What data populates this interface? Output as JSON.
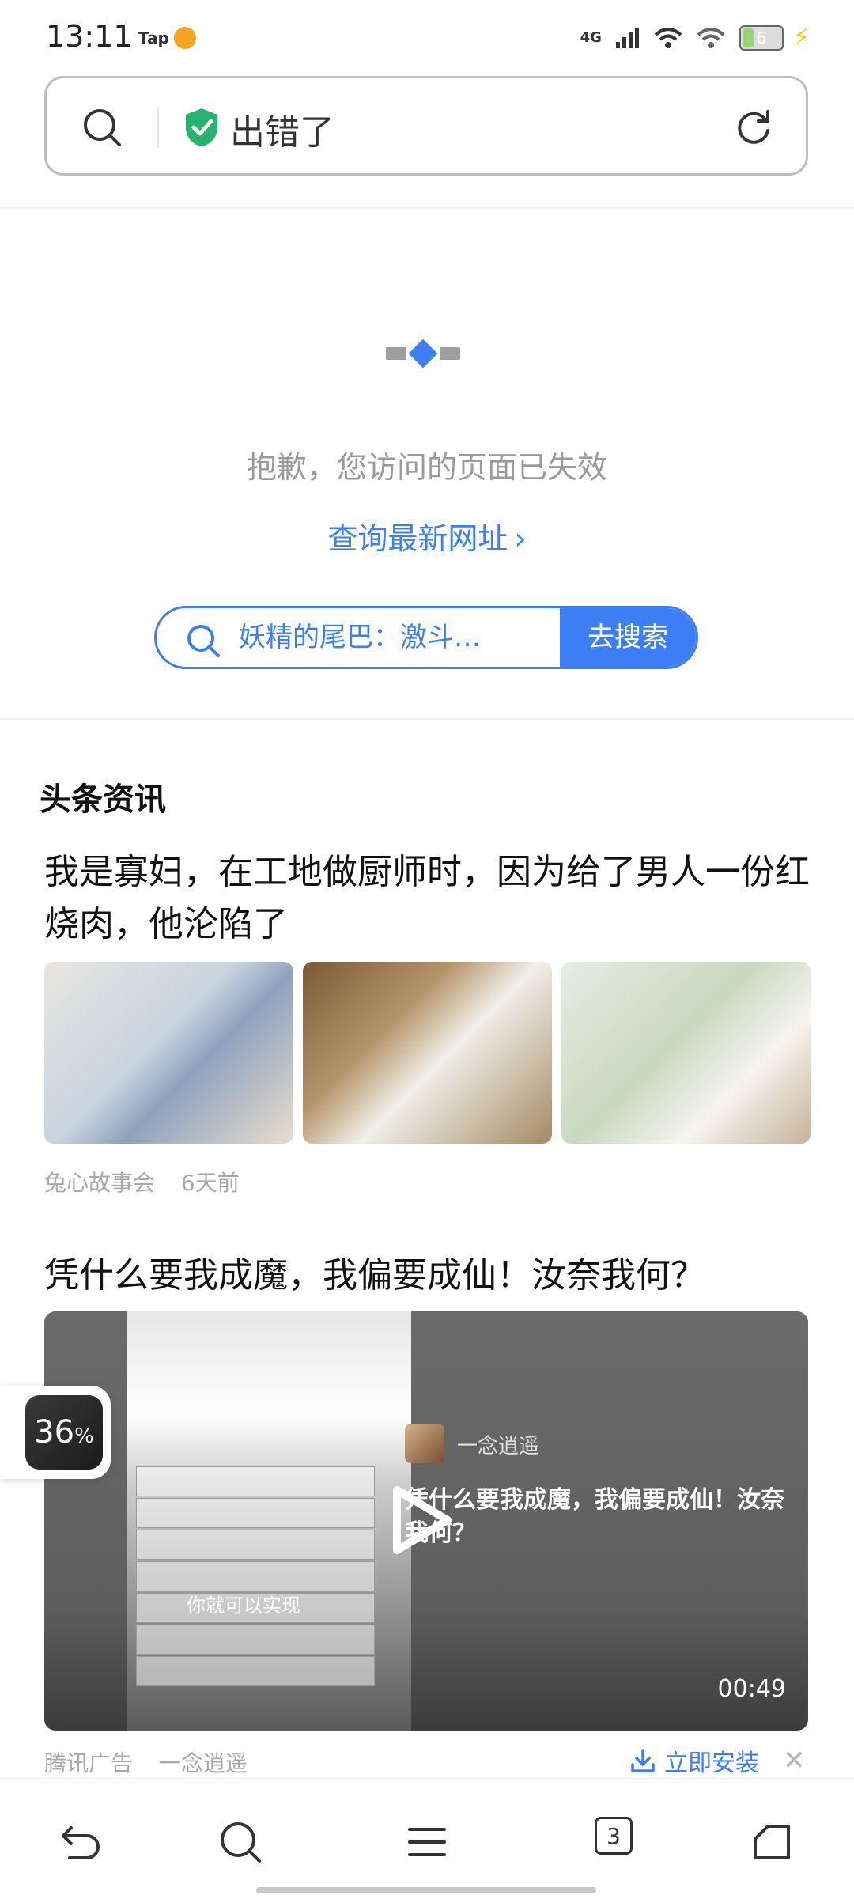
{
  "status_bar": {
    "time": "13:11",
    "tap_label": "Tap",
    "network": "4G",
    "battery": "6"
  },
  "address_bar": {
    "title": "出错了",
    "search_icon": "search-icon",
    "secure_icon": "shield-check-icon",
    "reload_icon": "reload-icon"
  },
  "error_page": {
    "message": "抱歉，您访问的页面已失效",
    "link_label": "查询最新网址",
    "search_suggestion": "妖精的尾巴：激斗…",
    "search_button": "去搜索"
  },
  "news": {
    "section_title": "头条资讯",
    "items": [
      {
        "title": "我是寡妇，在工地做厨师时，因为给了男人一份红烧肉，他沦陷了",
        "source": "兔心故事会",
        "time": "6天前"
      }
    ]
  },
  "ad": {
    "title": "凭什么要我成魔，我偏要成仙！汝奈我何？",
    "video_source": "一念逍遥",
    "video_desc": "凭什么要我成魔，我偏要成仙！汝奈我何？",
    "video_subtitle": "你就可以实现",
    "duration": "00:49",
    "ad_label": "腾讯广告",
    "advertiser": "一念逍遥",
    "install_label": "立即安装",
    "progress_value": "36",
    "progress_unit": "%"
  },
  "bottom_nav": {
    "tab_count": "3"
  },
  "colors": {
    "accent": "#3d7ef5",
    "muted": "#9a9a9a"
  }
}
